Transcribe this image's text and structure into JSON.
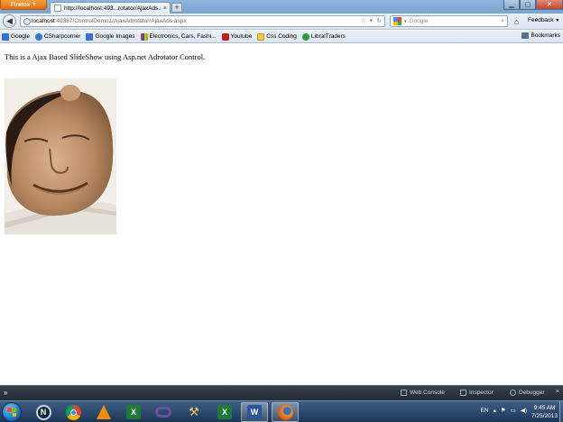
{
  "browser": {
    "menu_button_label": "Firefox",
    "tab_title": "http://localhost:493...rotator/AjaxAds.aspx",
    "url_host": "localhost",
    "url_rest": ":49387/ControlDemo1/AjaxAdrotator/AjaxAds.aspx",
    "search_placeholder": "Google",
    "feedback_label": "Feedback"
  },
  "bookmarks": {
    "items": [
      {
        "label": "Google",
        "icon": "google-favicon-icon",
        "color": "#3b6fd6"
      },
      {
        "label": "CSharpcorner",
        "icon": "csharpcorner-favicon-icon",
        "color": "#2f7bd1"
      },
      {
        "label": "Google Images",
        "icon": "google-favicon-icon",
        "color": "#3b6fd6"
      },
      {
        "label": "Electronics, Cars, Fashi...",
        "icon": "ebay-favicon-icon",
        "color": "#e53238"
      },
      {
        "label": "Youtube",
        "icon": "youtube-favicon-icon",
        "color": "#cc181e"
      },
      {
        "label": "Css Coding",
        "icon": "folder-icon",
        "color": "#f3c94a"
      },
      {
        "label": "LibralTraders",
        "icon": "libraltraders-favicon-icon",
        "color": "#2f9a3a"
      }
    ],
    "menu_label": "Bookmarks"
  },
  "page": {
    "heading": "This is a Ajax Based SlideShow using Asp.net Adrotator Control."
  },
  "devtools": {
    "command_label": "»",
    "tools": [
      "Web Console",
      "Inspector",
      "Debugger"
    ],
    "close_label": "×"
  },
  "taskbar": {
    "apps": [
      "start-orb",
      "norton-icon",
      "chrome-icon",
      "vlc-icon",
      "excel-icon",
      "visual-studio-icon",
      "tools-icon",
      "excel-icon",
      "word-icon",
      "firefox-icon"
    ],
    "language": "EN",
    "time": "9:45 AM",
    "date": "7/25/2013"
  },
  "colors": {
    "titlebar": "#8fb6dd",
    "firefox_orange": "#e26d10",
    "devbar": "#2b343d",
    "taskbar": "#2a4669"
  }
}
